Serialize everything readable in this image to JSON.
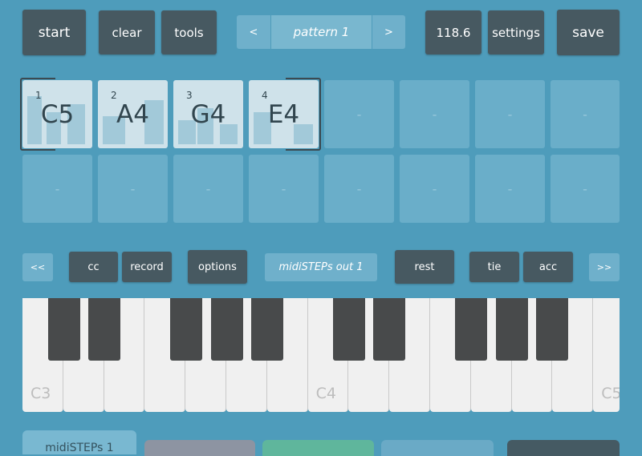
{
  "toolbar": {
    "start": "start",
    "clear": "clear",
    "tools": "tools",
    "prev": "<",
    "pattern": "pattern 1",
    "next": ">",
    "tempo": "118.6",
    "settings": "settings",
    "save": "save"
  },
  "steps": {
    "top": [
      {
        "num": "1",
        "note": "C5"
      },
      {
        "num": "2",
        "note": "A4"
      },
      {
        "num": "3",
        "note": "G4"
      },
      {
        "num": "4",
        "note": "E4"
      },
      {
        "note": "-"
      },
      {
        "note": "-"
      },
      {
        "note": "-"
      },
      {
        "note": "-"
      }
    ],
    "bottom": [
      "-",
      "-",
      "-",
      "-",
      "-",
      "-",
      "-",
      "-"
    ]
  },
  "controls": {
    "shift_left": "<<",
    "cc": "cc",
    "record": "record",
    "options": "options",
    "output": "midiSTEPs out 1",
    "rest": "rest",
    "tie": "tie",
    "acc": "acc",
    "shift_right": ">>"
  },
  "keyboard": {
    "labels": {
      "c3": "C3",
      "c4": "C4",
      "c5": "C5"
    }
  },
  "tabs": {
    "first": "midiSTEPs 1"
  },
  "colors": {
    "background": "#4e9cbb",
    "button_dark": "#475961",
    "button_light": "#6fb0cb",
    "tab_mauve": "#8d94a2",
    "tab_green": "#5fb69c",
    "tab_blue": "#6aaac6",
    "tab_dark": "#455a63"
  }
}
